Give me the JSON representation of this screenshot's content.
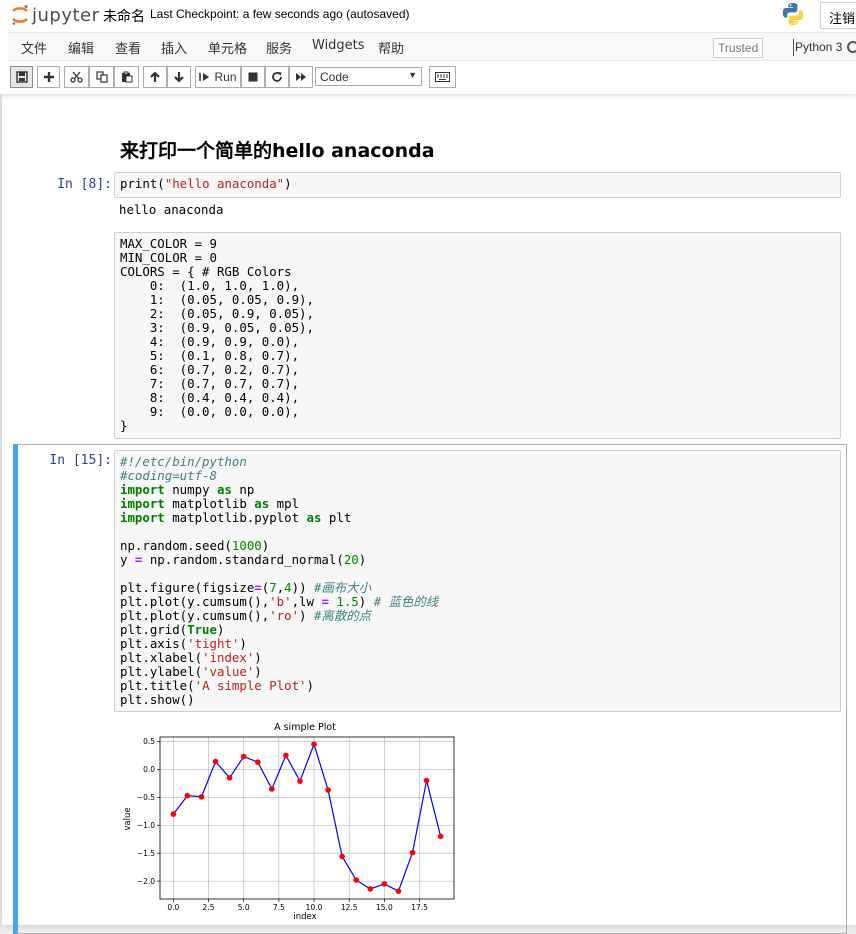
{
  "header": {
    "logo_text": "jupyter",
    "notebook_title": "未命名",
    "checkpoint": "Last Checkpoint: a few seconds ago  (autosaved)",
    "logout_label": "注销"
  },
  "menu": {
    "items": [
      "文件",
      "编辑",
      "查看",
      "插入",
      "单元格",
      "服务",
      "Widgets",
      "帮助"
    ],
    "trusted": "Trusted",
    "kernel": "Python 3"
  },
  "toolbar": {
    "run_label": "Run",
    "cell_type": "Code",
    "icons": [
      "save-icon",
      "plus-icon",
      "cut-icon",
      "copy-icon",
      "paste-icon",
      "arrow-up-icon",
      "arrow-down-icon",
      "run-icon",
      "stop-icon",
      "restart-icon",
      "fast-forward-icon",
      "keyboard-icon"
    ]
  },
  "cells": {
    "markdown_heading": "来打印一个简单的hello anaconda",
    "cell1": {
      "prompt": "In [8]:",
      "code_prefix": "print(",
      "code_string": "\"hello anaconda\"",
      "code_suffix": ")",
      "output": "hello anaconda"
    },
    "cell2": {
      "code": "MAX_COLOR = 9\nMIN_COLOR = 0\nCOLORS = { # RGB Colors\n    0:  (1.0, 1.0, 1.0),\n    1:  (0.05, 0.05, 0.9),\n    2:  (0.05, 0.9, 0.05),\n    3:  (0.9, 0.05, 0.05),\n    4:  (0.9, 0.9, 0.0),\n    5:  (0.1, 0.8, 0.7),\n    6:  (0.7, 0.2, 0.7),\n    7:  (0.7, 0.7, 0.7),\n    8:  (0.4, 0.4, 0.4),\n    9:  (0.0, 0.0, 0.0),\n}"
    },
    "cell3": {
      "prompt": "In [15]:",
      "t1": "#!/etc/bin/python",
      "t2": "#coding=utf-8",
      "t3": "import",
      "t4": " numpy ",
      "t5": "as",
      "t6": " np",
      "t7": "import",
      "t8": " matplotlib ",
      "t9": "as",
      "t10": " mpl",
      "t11": "import",
      "t12": " matplotlib.pyplot ",
      "t13": "as",
      "t14": " plt",
      "t15": "np.random.seed(",
      "t16": "1000",
      "t17": ")",
      "t18": "y ",
      "t19": "=",
      "t20": " np.random.standard_normal(",
      "t21": "20",
      "t22": ")",
      "t23": "plt.figure(figsize",
      "t24": "=",
      "t25": "(",
      "t26": "7",
      "t27": ",",
      "t28": "4",
      "t29": ")) ",
      "t30": "#画布大小",
      "t31": "plt.plot(y.cumsum(),",
      "t32": "'b'",
      "t33": ",lw ",
      "t34": "=",
      "t35": " ",
      "t36": "1.5",
      "t37": ") ",
      "t38": "# 蓝色的线",
      "t39": "plt.plot(y.cumsum(),",
      "t40": "'ro'",
      "t41": ") ",
      "t42": "#离散的点",
      "t43": "plt.grid(",
      "t44": "True",
      "t45": ")",
      "t46": "plt.axis(",
      "t47": "'tight'",
      "t48": ")",
      "t49": "plt.xlabel(",
      "t50": "'index'",
      "t51": ")",
      "t52": "plt.ylabel(",
      "t53": "'value'",
      "t54": ")",
      "t55": "plt.title(",
      "t56": "'A simple Plot'",
      "t57": ")",
      "t58": "plt.show()"
    }
  },
  "chart_data": {
    "type": "line",
    "title": "A simple Plot",
    "xlabel": "index",
    "ylabel": "value",
    "x": [
      0,
      1,
      2,
      3,
      4,
      5,
      6,
      7,
      8,
      9,
      10,
      11,
      12,
      13,
      14,
      15,
      16,
      17,
      18,
      19
    ],
    "y": [
      -0.8,
      -0.47,
      -0.49,
      0.14,
      -0.15,
      0.23,
      0.13,
      -0.35,
      0.25,
      -0.21,
      0.45,
      -0.37,
      -1.56,
      -1.98,
      -2.14,
      -2.05,
      -2.18,
      -1.49,
      -0.2,
      -1.2
    ],
    "xlim": [
      -0.95,
      19.95
    ],
    "ylim": [
      -2.32,
      0.58
    ],
    "xticks": [
      0.0,
      2.5,
      5.0,
      7.5,
      10.0,
      12.5,
      15.0,
      17.5
    ],
    "xtick_labels": [
      "0.0",
      "2.5",
      "5.0",
      "7.5",
      "10.0",
      "12.5",
      "15.0",
      "17.5"
    ],
    "yticks": [
      0.5,
      0.0,
      -0.5,
      -1.0,
      -1.5,
      -2.0
    ],
    "ytick_labels": [
      "0.5",
      "0.0",
      "−0.5",
      "−1.0",
      "−1.5",
      "−2.0"
    ],
    "grid": true,
    "line_color": "#0000ff",
    "marker_color": "#ff0000"
  }
}
